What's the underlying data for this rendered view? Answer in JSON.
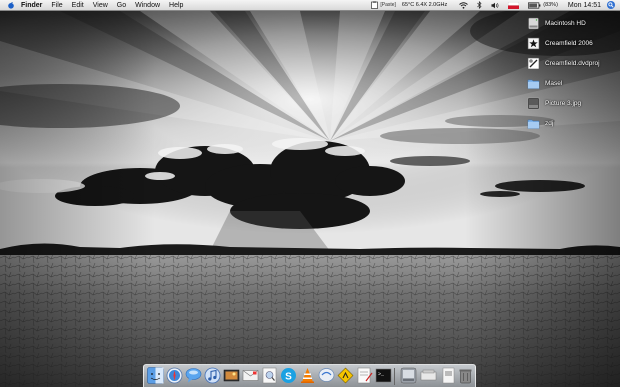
{
  "menubar": {
    "app_name": "Finder",
    "menus": [
      "File",
      "Edit",
      "View",
      "Go",
      "Window",
      "Help"
    ],
    "status": {
      "paste_label": "[Paste]",
      "cpu_info": "65°C 6.4X 2.0GHz",
      "battery": "(83%)",
      "clock": "Mon 14:51"
    }
  },
  "desktop_icons": [
    {
      "label": "Macintosh HD",
      "icon": "hard-drive-icon"
    },
    {
      "label": "Creamfield 2006",
      "icon": "movie-clapper-icon"
    },
    {
      "label": "Creamfield.dvdproj",
      "icon": "dvd-project-icon"
    },
    {
      "label": "Masel",
      "icon": "folder-icon"
    },
    {
      "label": "Picture 3.jpg",
      "icon": "image-file-icon"
    },
    {
      "label": "zdj",
      "icon": "folder-icon"
    }
  ],
  "dock": {
    "apps": [
      "finder-icon",
      "safari-icon",
      "ichat-icon",
      "itunes-icon",
      "iphoto-icon",
      "mail-icon",
      "preview-icon",
      "skype-icon",
      "vlc-icon",
      "messenger-icon",
      "gps-icon",
      "editor-icon",
      "terminal-icon"
    ],
    "others": [
      "system-preferences-icon",
      "stack-icon",
      "document-icon",
      "trash-icon"
    ]
  },
  "colors": {
    "menubar": "#e4e4e4",
    "dock": "#c8ccd0",
    "label_text": "#ffffff"
  }
}
